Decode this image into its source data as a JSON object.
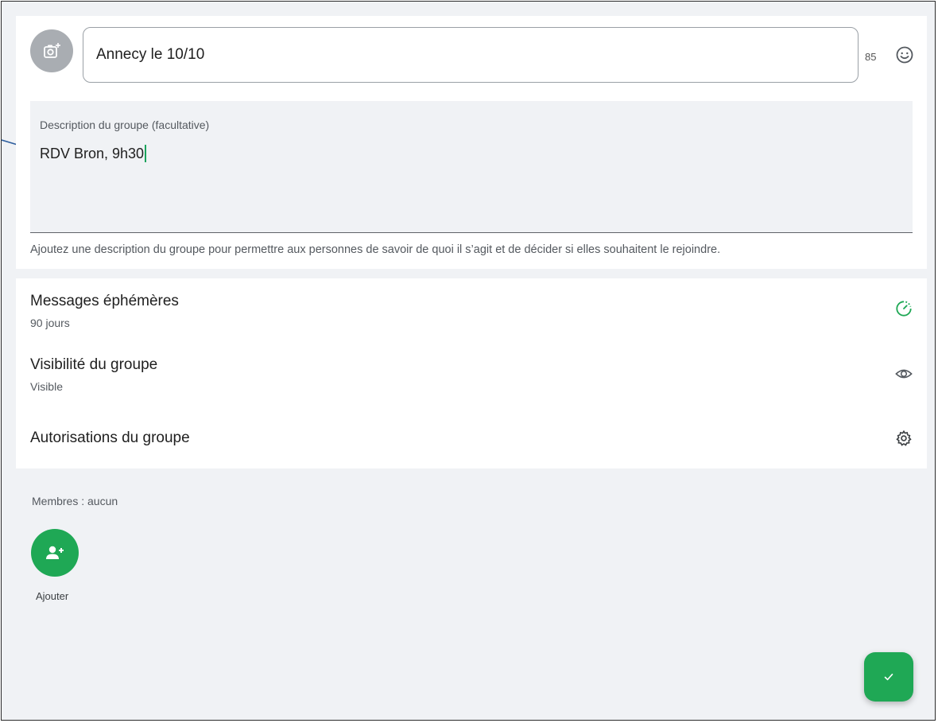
{
  "group": {
    "name_value": "Annecy le 10/10",
    "char_count": "85"
  },
  "description": {
    "label": "Description du groupe (facultative)",
    "value": "RDV Bron, 9h30",
    "helper": "Ajoutez une description du groupe pour permettre aux personnes de savoir de quoi il s’agit et de décider si elles souhaitent le rejoindre."
  },
  "settings": {
    "ephemeral": {
      "title": "Messages éphémères",
      "subtitle": "90 jours",
      "icon": "timer-icon"
    },
    "visibility": {
      "title": "Visibilité du groupe",
      "subtitle": "Visible",
      "icon": "eye-icon"
    },
    "permissions": {
      "title": "Autorisations du groupe",
      "icon": "gear-icon"
    }
  },
  "members": {
    "label": "Membres : aucun",
    "add_label": "Ajouter"
  },
  "colors": {
    "accent": "#1fa855",
    "background": "#f0f2f5",
    "annotation_arrow": "#2f5f9e"
  }
}
